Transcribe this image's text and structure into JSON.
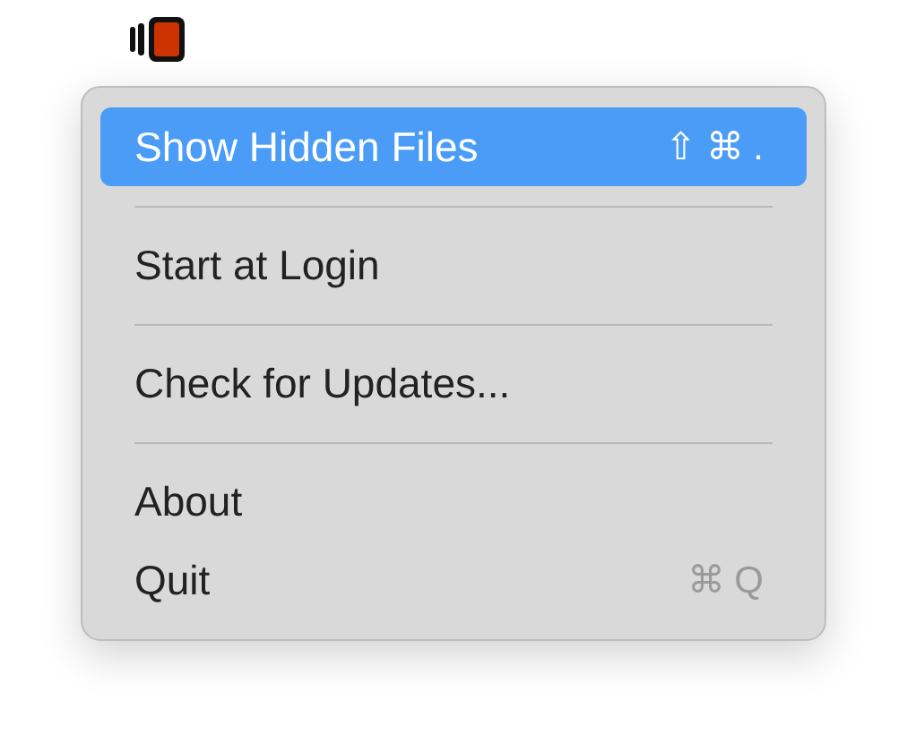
{
  "menu": {
    "items": [
      {
        "kind": "item",
        "label": "Show Hidden Files",
        "shortcut": "⇧⌘.",
        "selected": true
      },
      {
        "kind": "separator"
      },
      {
        "kind": "item",
        "label": "Start at Login",
        "selected": false
      },
      {
        "kind": "separator"
      },
      {
        "kind": "item",
        "label": "Check for Updates...",
        "selected": false
      },
      {
        "kind": "separator"
      },
      {
        "kind": "item",
        "label": "About",
        "selected": false
      },
      {
        "kind": "item",
        "label": "Quit",
        "shortcut": "⌘Q",
        "selected": false
      }
    ]
  }
}
